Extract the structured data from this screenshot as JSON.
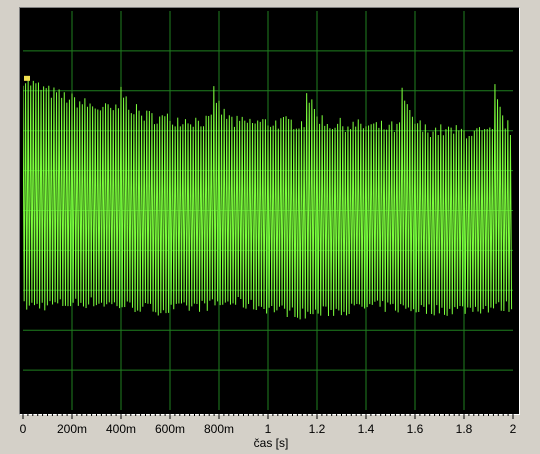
{
  "chart_data": {
    "type": "line",
    "xlabel": "čas [s]",
    "ylabel": "",
    "xlim": [
      0,
      2
    ],
    "x_tick_values": [
      0,
      0.2,
      0.4,
      0.6,
      0.8,
      1.0,
      1.2,
      1.4,
      1.6,
      1.8,
      2.0
    ],
    "x_tick_labels": [
      "0",
      "200m",
      "400m",
      "600m",
      "800m",
      "1",
      "1.2",
      "1.4",
      "1.6",
      "1.8",
      "2"
    ],
    "grid": true,
    "series": [
      {
        "color": "#7cff3c",
        "oscillation_frequency_hz": 95,
        "upper_envelope_norm": [
          0.82,
          0.76,
          0.73,
          0.72,
          0.72,
          0.71,
          0.7,
          0.69
        ],
        "lower_envelope_norm": [
          0.26,
          0.27,
          0.25,
          0.27,
          0.24,
          0.26,
          0.25,
          0.26
        ],
        "peak_spikes_s": [
          0.0,
          0.39,
          0.77,
          1.15,
          1.54,
          1.92
        ],
        "peak_spike_norm": 0.83
      }
    ]
  },
  "colors": {
    "background": "#000000",
    "grid": "#1f7f1f",
    "trace": "#7cff3c",
    "frame": "#d4d0c8",
    "cursor": "#f0e050"
  }
}
